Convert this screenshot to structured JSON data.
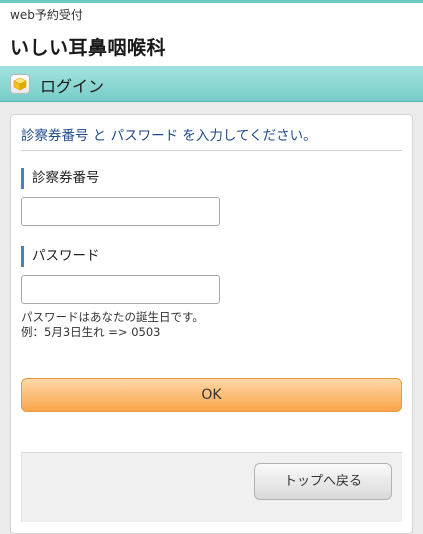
{
  "header": {
    "subtitle": "web予約受付",
    "clinic_name": "いしい耳鼻咽喉科"
  },
  "section": {
    "title": "ログイン",
    "icon": "cube-icon"
  },
  "form": {
    "instruction": "診察券番号 と パスワード を入力してください。",
    "card_number_label": "診察券番号",
    "card_number_value": "",
    "password_label": "パスワード",
    "password_value": "",
    "hint_line1": "パスワードはあなたの誕生日です。",
    "hint_line2": "例：5月3日生れ => 0503",
    "ok_label": "OK"
  },
  "footer": {
    "back_label": "トップへ戻る"
  },
  "colors": {
    "accent": "#6cc9c4",
    "instruction_text": "#1e4a8c",
    "label_bar": "#4a7fc0",
    "ok_button": "#f9a54c"
  }
}
